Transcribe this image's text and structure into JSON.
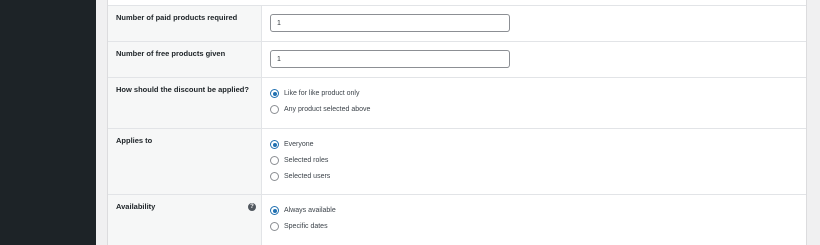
{
  "rows": {
    "paid": {
      "label": "Number of paid products required",
      "value": "1"
    },
    "free": {
      "label": "Number of free products given",
      "value": "1"
    },
    "discount": {
      "label": "How should the discount be applied?",
      "options": [
        "Like for like product only",
        "Any product selected above"
      ],
      "selected": "Like for like product only"
    },
    "applies_to": {
      "label": "Applies to",
      "options": [
        "Everyone",
        "Selected roles",
        "Selected users"
      ],
      "selected": "Everyone"
    },
    "availability": {
      "label": "Availability",
      "help_icon": "?",
      "options": [
        "Always available",
        "Specific dates"
      ],
      "selected": "Always available"
    }
  },
  "colors": {
    "accent": "#2271b1",
    "sidebar": "#1d2327",
    "label_bg": "#f6f7f7"
  }
}
